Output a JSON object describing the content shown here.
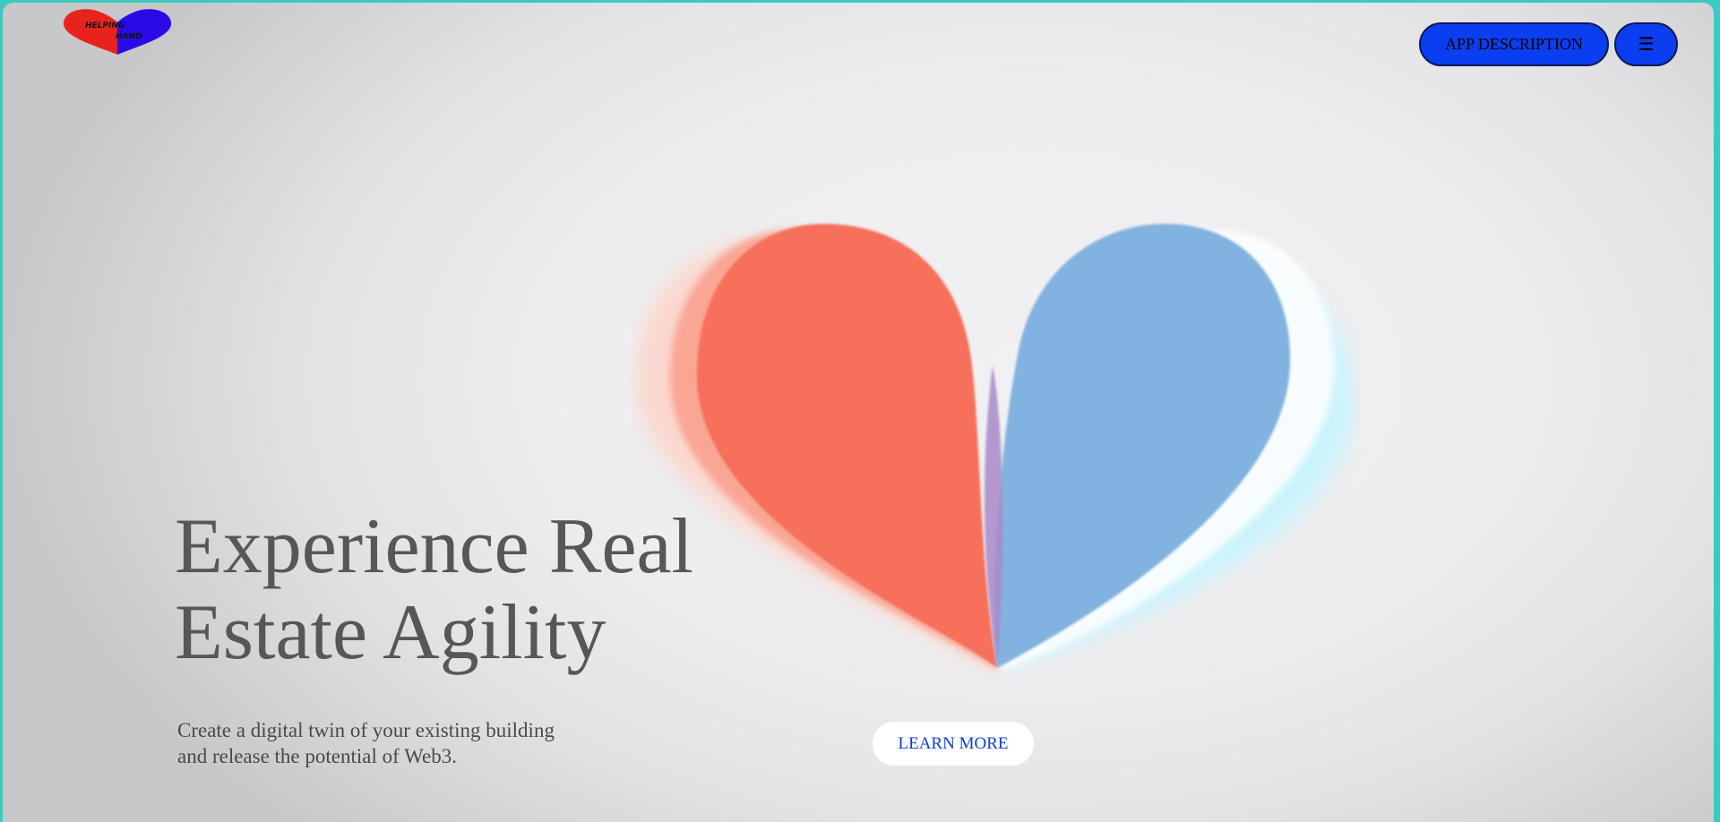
{
  "logo": {
    "text_line1": "HELPING",
    "text_line2": "HAND"
  },
  "header": {
    "app_description_label": "APP DESCRIPTION",
    "menu_glyph": "☰"
  },
  "hero": {
    "title_line1": "Experience Real",
    "title_line2": "Estate Agility",
    "subtitle_line1": "Create a digital twin of your existing building",
    "subtitle_line2": "and release the potential of Web3.",
    "cta_label": "LEARN MORE"
  },
  "colors": {
    "accent_blue": "#0a3ef0",
    "heart_red": "#f7705c",
    "heart_blue": "#82b2e0",
    "frame_border": "#3cc9bf"
  },
  "icons": {
    "menu": "hamburger-menu-icon",
    "logo": "heart-logo-icon"
  }
}
